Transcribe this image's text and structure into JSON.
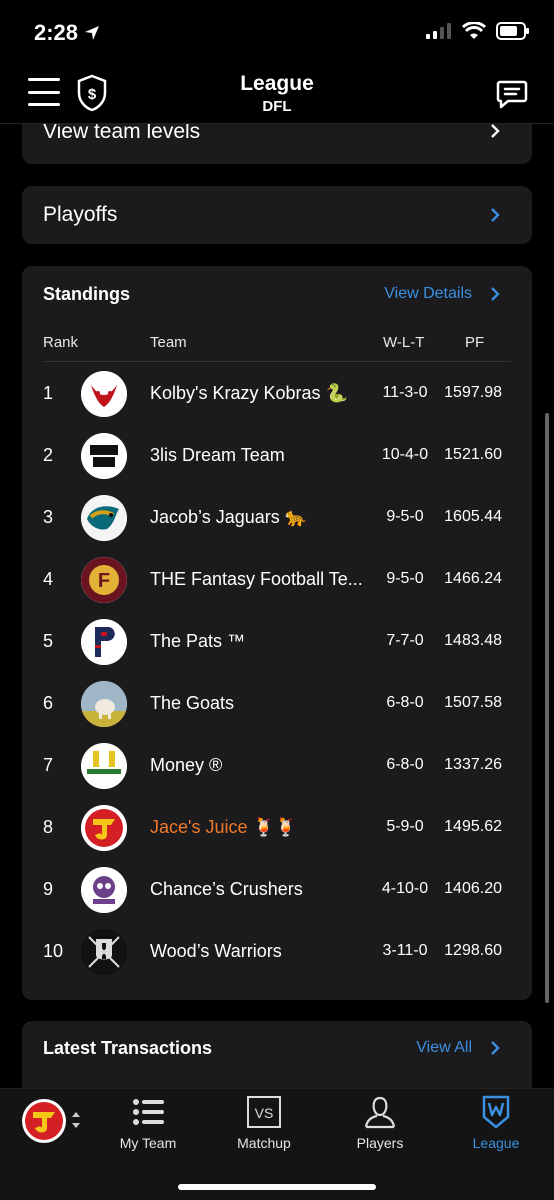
{
  "status": {
    "time": "2:28"
  },
  "header": {
    "title": "League",
    "subtitle": "DFL"
  },
  "rows": {
    "team_levels": "View team levels",
    "playoffs": "Playoffs"
  },
  "standings": {
    "title": "Standings",
    "view_details": "View Details",
    "columns": {
      "rank": "Rank",
      "team": "Team",
      "wlt": "W-L-T",
      "pf": "PF"
    },
    "teams": [
      {
        "rank": "1",
        "name": "Kolby's Krazy Kobras 🐍",
        "wlt": "11-3-0",
        "pf": "1597.98"
      },
      {
        "rank": "2",
        "name": "3lis Dream Team",
        "wlt": "10-4-0",
        "pf": "1521.60"
      },
      {
        "rank": "3",
        "name": "Jacob’s Jaguars 🐆",
        "wlt": "9-5-0",
        "pf": "1605.44"
      },
      {
        "rank": "4",
        "name": "THE Fantasy Football Te...",
        "wlt": "9-5-0",
        "pf": "1466.24"
      },
      {
        "rank": "5",
        "name": "The Pats ™",
        "wlt": "7-7-0",
        "pf": "1483.48"
      },
      {
        "rank": "6",
        "name": "The Goats",
        "wlt": "6-8-0",
        "pf": "1507.58"
      },
      {
        "rank": "7",
        "name": "Money ®",
        "wlt": "6-8-0",
        "pf": "1337.26"
      },
      {
        "rank": "8",
        "name": "Jace's Juice 🍹🍹",
        "wlt": "5-9-0",
        "pf": "1495.62"
      },
      {
        "rank": "9",
        "name": "Chance’s Crushers",
        "wlt": "4-10-0",
        "pf": "1406.20"
      },
      {
        "rank": "10",
        "name": "Wood’s Warriors",
        "wlt": "3-11-0",
        "pf": "1298.60"
      }
    ]
  },
  "transactions": {
    "title": "Latest Transactions",
    "view_all": "View All"
  },
  "tabs": {
    "my_team": "My Team",
    "matchup": "Matchup",
    "players": "Players",
    "league": "League"
  },
  "colors": {
    "accent": "#3a8fe0",
    "highlight_team": "#f07a2a",
    "card": "#1b1b1d"
  }
}
